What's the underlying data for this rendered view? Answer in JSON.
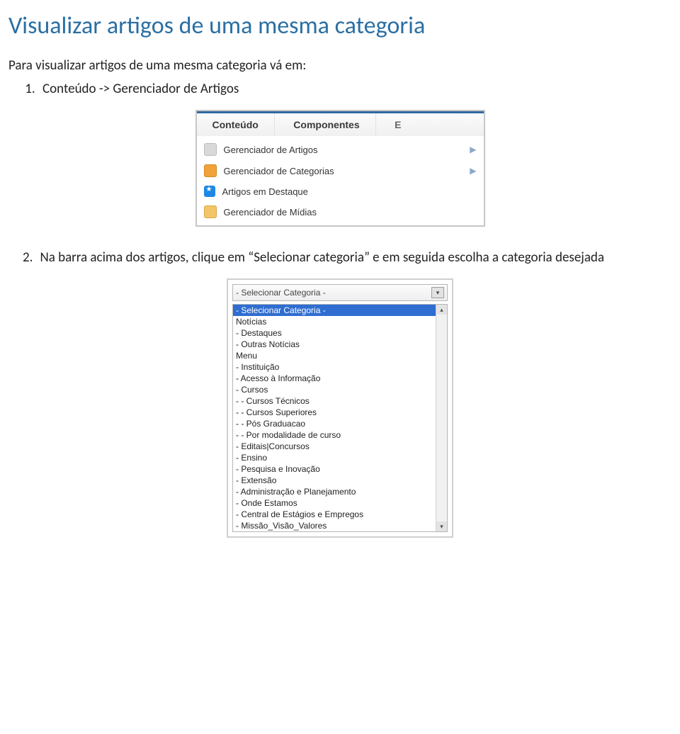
{
  "title": "Visualizar artigos de uma mesma categoria",
  "intro": "Para visualizar artigos de uma mesma categoria vá em:",
  "step1": "Conteúdo -> Gerenciador de Artigos",
  "step2": "Na barra acima dos artigos, clique em “Selecionar categoria” e em seguida escolha a categoria desejada",
  "fig1": {
    "tab_conteudo": "Conteúdo",
    "tab_componentes": "Componentes",
    "tab_extra": "E",
    "items": [
      "Gerenciador de Artigos",
      "Gerenciador de Categorias",
      "Artigos em Destaque",
      "Gerenciador de Mídias"
    ]
  },
  "fig2": {
    "closed_label": "- Selecionar Categoria -",
    "options": [
      "- Selecionar Categoria -",
      "Notícias",
      "- Destaques",
      "- Outras Notícias",
      "Menu",
      "- Instituição",
      "- Acesso à Informação",
      "- Cursos",
      "- - Cursos Técnicos",
      "- - Cursos Superiores",
      "- - Pós Graduacao",
      "- - Por modalidade de curso",
      "- Editais|Concursos",
      "- Ensino",
      "- Pesquisa e Inovação",
      "- Extensão",
      "- Administração e Planejamento",
      "- Onde Estamos",
      "- Central de Estágios e Empregos",
      "- Missão_Visão_Valores"
    ]
  }
}
